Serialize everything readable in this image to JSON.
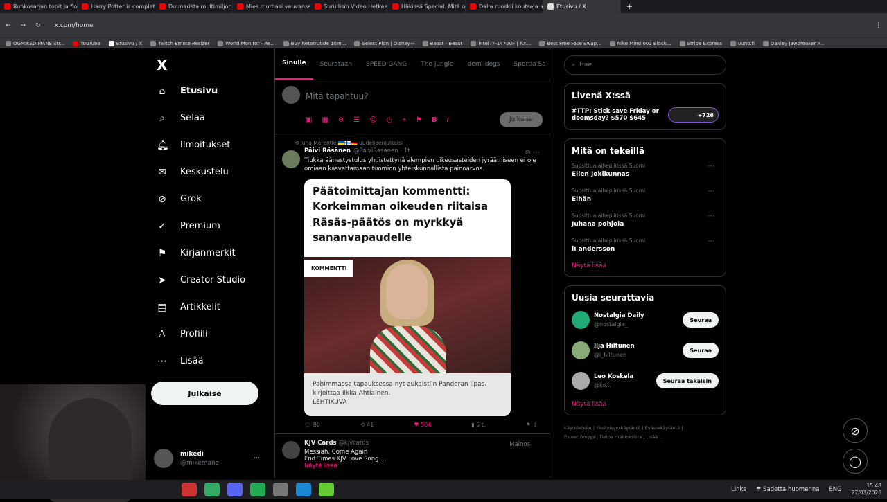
{
  "browser": {
    "tabs": [
      "Runkosarjan topit ja flopit",
      "Harry Potter is completely",
      "Duunarista multimiljonää",
      "Mies murhasi vauvansa",
      "Surullisin Video Hetkeen",
      "Häkissä Special: Mitä oik",
      "Dalla ruoskii koutseja + K",
      "Etusivu / X"
    ],
    "url": "x.com/home",
    "bookmarks": [
      "OGMIKEDIMANE Str...",
      "YouTube",
      "Etusivu / X",
      "Twitch Emote Resizer",
      "World Monitor - Re...",
      "Buy Retatrutide 10m...",
      "Select Plan | Disney+",
      "Beast - Beast",
      "Intel i7-14700F | RX...",
      "Best Free Face Swap...",
      "Nike Mind 002 Black...",
      "Stripe Express",
      "uuno.fi",
      "Oakley Jawbreaker P..."
    ]
  },
  "nav": {
    "logo": "X",
    "items": [
      {
        "label": "Etusivu",
        "icon": "⌂"
      },
      {
        "label": "Selaa",
        "icon": "⌕"
      },
      {
        "label": "Ilmoitukset",
        "icon": "🔔︎"
      },
      {
        "label": "Keskustelu",
        "icon": "✉"
      },
      {
        "label": "Grok",
        "icon": "⊘"
      },
      {
        "label": "Premium",
        "icon": "✓"
      },
      {
        "label": "Kirjanmerkit",
        "icon": "⚑"
      },
      {
        "label": "Creator Studio",
        "icon": "➤"
      },
      {
        "label": "Artikkelit",
        "icon": "▤"
      },
      {
        "label": "Profiili",
        "icon": "♙"
      },
      {
        "label": "Lisää",
        "icon": "⋯"
      }
    ],
    "post_button": "Julkaise",
    "profile": {
      "name": "mikedi",
      "handle": "@mikemane"
    }
  },
  "feed": {
    "tabs": [
      "Sinulle",
      "Seurataan",
      "SPEED GANG",
      "The jungle",
      "demi dogs",
      "Sportla Sa"
    ],
    "compose_placeholder": "Mitä tapahtuu?",
    "compose_button": "Julkaise",
    "post": {
      "repost_line": "Juha Merentie 🇺🇦🇫🇮🇩🇪 uudelleenjulkaisi",
      "name": "Päivi Räsänen",
      "handle": "@PaiviRasanen · 1t",
      "text": "Tiukka äänestystulos yhdistettynä alempien oikeusasteiden jyräämiseen ei ole omiaan kasvattamaan tuomion yhteiskunnallista painoarvoa.",
      "card_title": "Päätoimittajan kommentti: Korkeimman oikeuden riitaisa Räsäs-päätös on myrkkyä sananvapaudelle",
      "card_badge": "KOMMENTTI",
      "card_caption": "Pahimmassa tapauksessa nyt aukaistiin Pandoran lipas, kirjoittaa Ilkka Ahtiainen.",
      "card_source": "LEHTIKUVA",
      "replies": "80",
      "reposts": "41",
      "likes": "564",
      "views": "5 t."
    },
    "ad": {
      "name": "KJV Cards",
      "handle": "@kjvcards",
      "label": "Mainos",
      "line1": "Messiah, Come Again",
      "line2": "End Times KJV Love Song ...",
      "more": "Näytä lisää"
    }
  },
  "sidebar": {
    "search_placeholder": "Hae",
    "live": {
      "title": "Livenä X:ssä",
      "text": "#TTP: Stick save Friday or doomsday? $570 $645",
      "count": "+726"
    },
    "trends": {
      "title": "Mitä on tekeillä",
      "items": [
        {
          "context": "Suosittua aihepiirissä Suomi",
          "name": "Ellen Jokikunnas"
        },
        {
          "context": "Suosittua aihepiirissä Suomi",
          "name": "Eihän"
        },
        {
          "context": "Suosittua aihepiirissä Suomi",
          "name": "Juhana pohjola"
        },
        {
          "context": "Suosittua aihepiirissä Suomi",
          "name": "Ii andersson"
        }
      ],
      "more": "Näytä lisää"
    },
    "follow": {
      "title": "Uusia seurattavia",
      "items": [
        {
          "name": "Nostalgia Daily",
          "handle": "@nostalgia_",
          "button": "Seuraa"
        },
        {
          "name": "Ilja Hiltunen",
          "handle": "@i_hiltunen",
          "button": "Seuraa"
        },
        {
          "name": "Leo Koskela",
          "handle": "@ko...",
          "button": "Seuraa takaisin"
        }
      ],
      "more": "Näytä lisää"
    },
    "legal": [
      "Käyttöehdot",
      "Yksityisyyskäytäntö",
      "Evästekäytäntö",
      "Esteettömyys",
      "Tietoa mainoksista",
      "Lisää ..."
    ]
  },
  "taskbar": {
    "links": "Links",
    "weather": "Sadetta huomenna",
    "lang": "ENG",
    "time": "15.48",
    "date": "27/03/2026"
  },
  "colors": {
    "accent": "#f91880",
    "bg": "#000000",
    "border": "#2f3336"
  }
}
